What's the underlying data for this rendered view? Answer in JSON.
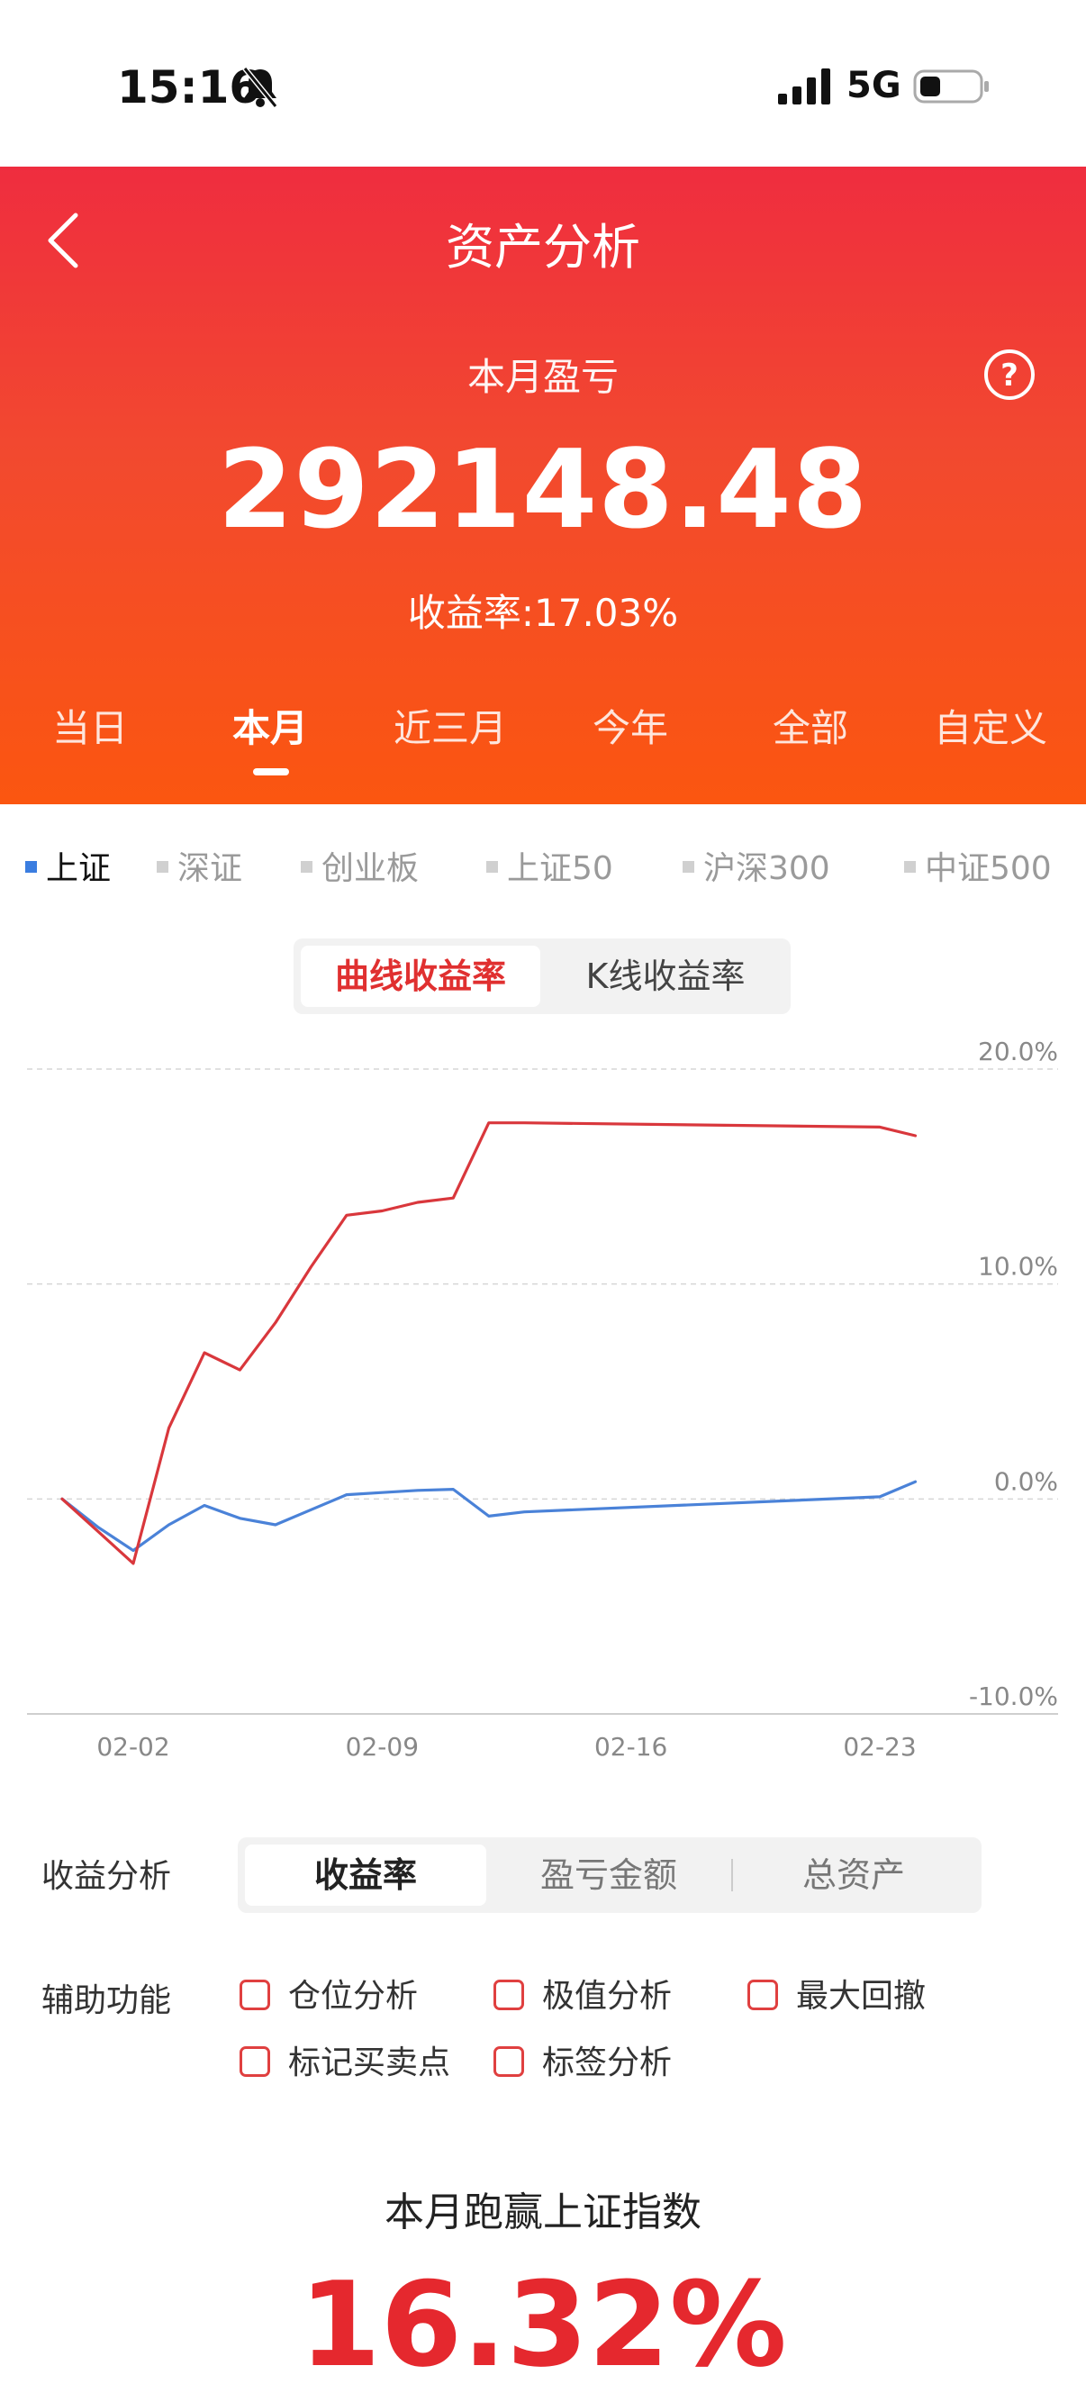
{
  "status_bar": {
    "time": "15:16",
    "network": "5G"
  },
  "header": {
    "title": "资产分析"
  },
  "summary": {
    "label": "本月盈亏",
    "amount": "292148.48",
    "rate_text": "收益率:17.03%"
  },
  "period_tabs": {
    "items": [
      "当日",
      "本月",
      "近三月",
      "今年",
      "全部",
      "自定义"
    ],
    "active_index": 1
  },
  "index_tabs": {
    "items": [
      "上证",
      "深证",
      "创业板",
      "上证50",
      "沪深300",
      "中证500"
    ],
    "active_index": 0
  },
  "chart_mode": {
    "options": [
      "曲线收益率",
      "K线收益率"
    ],
    "active_index": 0
  },
  "colors": {
    "header_top": "#ef2d3f",
    "header_bottom": "#fb5610",
    "portfolio_line": "#d9373c",
    "index_line": "#4a82d8",
    "accent": "#e5282e"
  },
  "chart_data": {
    "type": "line",
    "x_ticks": [
      "02-02",
      "02-09",
      "02-16",
      "02-23"
    ],
    "y_ticks": [
      "20.0%",
      "10.0%",
      "0.0%",
      "-10.0%"
    ],
    "ylim": [
      -10,
      20
    ],
    "x": [
      "01-31",
      "02-01",
      "02-02",
      "02-03",
      "02-04",
      "02-05",
      "02-06",
      "02-07",
      "02-08",
      "02-09",
      "02-10",
      "02-11",
      "02-12",
      "02-13",
      "02-23",
      "02-24"
    ],
    "series": [
      {
        "color": "#d9373c",
        "values": [
          0.0,
          -1.5,
          -3.0,
          3.3,
          6.8,
          6.0,
          8.2,
          10.8,
          13.2,
          13.4,
          13.8,
          14.0,
          17.5,
          17.5,
          17.3,
          16.9
        ]
      },
      {
        "color": "#4a82d8",
        "values": [
          0.0,
          -1.3,
          -2.4,
          -1.2,
          -0.3,
          -0.9,
          -1.2,
          -0.5,
          0.2,
          0.3,
          0.4,
          0.45,
          -0.8,
          -0.6,
          0.1,
          0.8
        ]
      }
    ],
    "grid": true
  },
  "analysis": {
    "label": "收益分析",
    "options": [
      "收益率",
      "盈亏金额",
      "总资产"
    ],
    "active_index": 0
  },
  "aux": {
    "label": "辅助功能",
    "items": [
      "仓位分析",
      "极值分析",
      "最大回撤",
      "标记买卖点",
      "标签分析"
    ]
  },
  "beat": {
    "title": "本月跑赢上证指数",
    "value": "16.32%"
  }
}
